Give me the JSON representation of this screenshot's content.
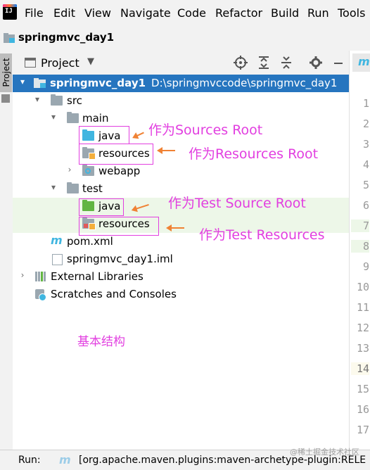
{
  "menubar": {
    "logo_text": "IJ",
    "items": [
      "File",
      "Edit",
      "View",
      "Navigate",
      "Code",
      "Refactor",
      "Build",
      "Run",
      "Tools"
    ]
  },
  "breadcrumb": {
    "project": "springmvc_day1"
  },
  "side_strip": {
    "project_tab": "Project"
  },
  "panel": {
    "title": "Project",
    "chevron": "▼"
  },
  "tree": {
    "root_name": "springmvc_day1",
    "root_path": "D:\\springmvccode\\springmvc_day1",
    "src": "src",
    "main": "main",
    "main_java": "java",
    "main_resources": "resources",
    "webapp": "webapp",
    "test": "test",
    "test_java": "java",
    "test_resources": "resources",
    "pom": "pom.xml",
    "iml": "springmvc_day1.iml",
    "external_libraries": "External Libraries",
    "scratches": "Scratches and Consoles"
  },
  "annotations": {
    "sources_root": "作为Sources Root",
    "resources_root": "作为Resources Root",
    "test_source_root": "作为Test Source Root",
    "test_resources": "作为Test Resources",
    "caption": "基本结构"
  },
  "editor_gutter": {
    "tab_icon": "m",
    "line_numbers": [
      "1",
      "2",
      "3",
      "4",
      "5",
      "6",
      "7",
      "8",
      "9",
      "10",
      "11",
      "12",
      "13",
      "14",
      "15",
      "16",
      "17"
    ],
    "current_line": "14"
  },
  "run_bar": {
    "label": "Run:",
    "icon": "maven-icon",
    "text": "[org.apache.maven.plugins:maven-archetype-plugin:RELE"
  },
  "watermark": "@稀土掘金技术社区",
  "colors": {
    "selection": "#2675bf",
    "annotation": "#e23fe0",
    "arrow": "#f08234",
    "source_folder": "#40b6e0",
    "test_folder": "#62b543"
  }
}
